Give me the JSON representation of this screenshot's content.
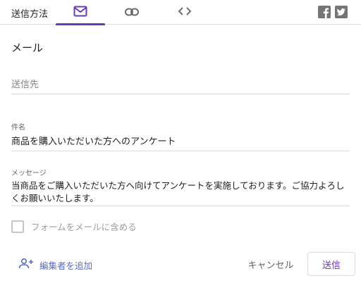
{
  "header": {
    "send_via_label": "送信方法",
    "tabs": [
      {
        "icon": "email-icon",
        "active": true
      },
      {
        "icon": "link-icon",
        "active": false
      },
      {
        "icon": "embed-code-icon",
        "active": false
      }
    ],
    "social": [
      {
        "icon": "facebook-icon"
      },
      {
        "icon": "twitter-icon"
      }
    ],
    "accent_color": "#673ab7"
  },
  "email": {
    "section_title": "メール",
    "to_placeholder": "送信先",
    "to_value": "",
    "subject_label": "件名",
    "subject_value": "商品を購入いただいた方へのアンケート",
    "message_label": "メッセージ",
    "message_value": "当商品をご購入いただいた方へ向けてアンケートを実施しております。ご協力よろしくお願いいたします。",
    "include_form_label": "フォームをメールに含める",
    "include_form_checked": false
  },
  "footer": {
    "add_editor_label": "編集者を追加",
    "cancel_label": "キャンセル",
    "send_label": "送信"
  }
}
